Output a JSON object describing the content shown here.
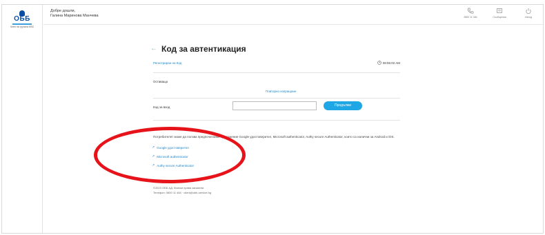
{
  "brand": {
    "logo_text": "ОББ",
    "logo_sub": "Член на групата KBC",
    "brand_color": "#0a4fa3",
    "accent_color": "#1ea7e4"
  },
  "header": {
    "greeting": "Добре дошли,",
    "user_name": "Галина Маринова Манчева",
    "actions": [
      {
        "label": "0800 11 464",
        "icon": "phone-icon"
      },
      {
        "label": "Съобщения",
        "icon": "message-icon"
      },
      {
        "label": "Изход",
        "icon": "power-icon"
      }
    ]
  },
  "page": {
    "title": "Код за автентикация",
    "register_link": "Регистриран на Код",
    "time": "08:55:02 AM",
    "remaining_label": "Оставащо",
    "resend_link": "Повторно изпращане",
    "code_label": "Код за вход",
    "code_input_value": "",
    "continue_button": "Продължи",
    "info_text": "Потребителят може да ползва предпочитания приложение Google удостоверител, Microsoft authenticator, Authy secure Authenticator, които са налични за Android и iOS.",
    "apps": [
      "Google удостоверител",
      "Microsoft authenticator",
      "Authy secure Authenticator"
    ],
    "footer_line1": "©2023 ОББ АД. Всички права запазени.",
    "footer_line2": "Телефон: 0800 11 464 · client@ubb-service.bg"
  },
  "annotation": {
    "highlight_color": "#e6141a"
  }
}
